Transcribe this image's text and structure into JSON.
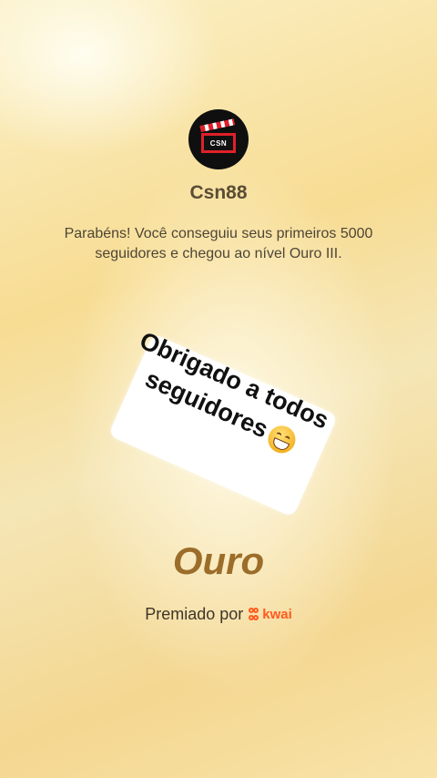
{
  "profile": {
    "avatar_text": "CSN",
    "username": "Csn88"
  },
  "message": "Parabéns! Você conseguiu seus primeiros 5000 seguidores e chegou ao nível Ouro III.",
  "sticker": {
    "line1": "Obrigado a todos",
    "line2": "seguidores",
    "emoji": "grinning-face-emoji"
  },
  "tier": "Ouro",
  "award": {
    "prefix": "Premiado por",
    "brand": "kwai"
  },
  "colors": {
    "tier_text": "#9c6d2a",
    "brand": "#ff5a1f",
    "avatar_bg": "#0f0f0f"
  }
}
